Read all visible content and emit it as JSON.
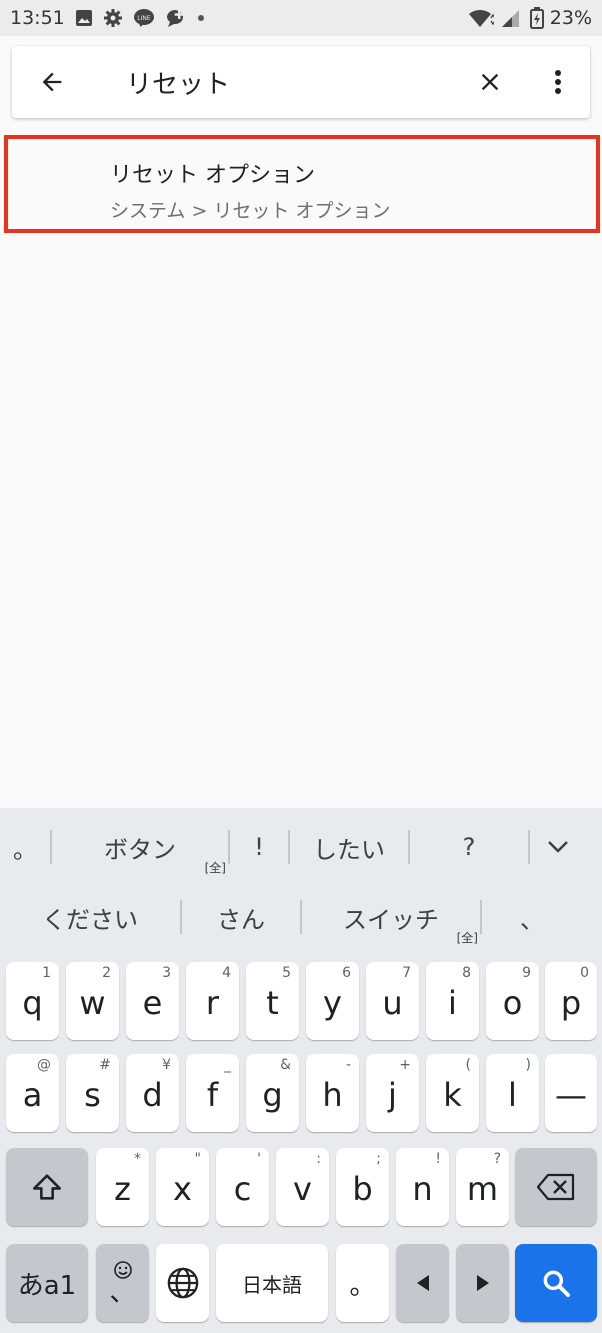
{
  "status_bar": {
    "time": "13:51",
    "battery": "23%",
    "line_badge": "LINE",
    "icons": [
      "image-icon",
      "gear-icon",
      "line-icon",
      "chat-plus-icon",
      "dot-icon",
      "wifi-icon",
      "signal-icon",
      "battery-icon"
    ]
  },
  "search": {
    "query": "リセット",
    "back_icon": "arrow-left-icon",
    "clear_icon": "close-icon",
    "more_icon": "more-vert-icon"
  },
  "result": {
    "title": "リセット オプション",
    "path": "システム > リセット オプション",
    "highlight_color": "#e8331f"
  },
  "keyboard": {
    "suggestions_row1": [
      "。",
      "ボタン",
      "!",
      "したい",
      "?"
    ],
    "suggestions_row1_zen": "[全]",
    "suggestions_row2": [
      "ください",
      "さん",
      "スイッチ",
      "、"
    ],
    "suggestions_row2_zen": "[全]",
    "row1": [
      {
        "char": "q",
        "hint": "1"
      },
      {
        "char": "w",
        "hint": "2"
      },
      {
        "char": "e",
        "hint": "3"
      },
      {
        "char": "r",
        "hint": "4"
      },
      {
        "char": "t",
        "hint": "5"
      },
      {
        "char": "y",
        "hint": "6"
      },
      {
        "char": "u",
        "hint": "7"
      },
      {
        "char": "i",
        "hint": "8"
      },
      {
        "char": "o",
        "hint": "9"
      },
      {
        "char": "p",
        "hint": "0"
      }
    ],
    "row2": [
      {
        "char": "a",
        "hint": "@"
      },
      {
        "char": "s",
        "hint": "#"
      },
      {
        "char": "d",
        "hint": "¥"
      },
      {
        "char": "f",
        "hint": "_"
      },
      {
        "char": "g",
        "hint": "&"
      },
      {
        "char": "h",
        "hint": "-"
      },
      {
        "char": "j",
        "hint": "+"
      },
      {
        "char": "k",
        "hint": "("
      },
      {
        "char": "l",
        "hint": ")"
      },
      {
        "char": "—",
        "hint": ""
      }
    ],
    "row3": [
      {
        "char": "z",
        "hint": "*"
      },
      {
        "char": "x",
        "hint": "\""
      },
      {
        "char": "c",
        "hint": "'"
      },
      {
        "char": "v",
        "hint": ":"
      },
      {
        "char": "b",
        "hint": ";"
      },
      {
        "char": "n",
        "hint": "!"
      },
      {
        "char": "m",
        "hint": "?"
      }
    ],
    "mode_key": "あa1",
    "emoji_comma": "、",
    "space_label": "日本語",
    "period_key": "。",
    "accent_color": "#1a73e8"
  }
}
